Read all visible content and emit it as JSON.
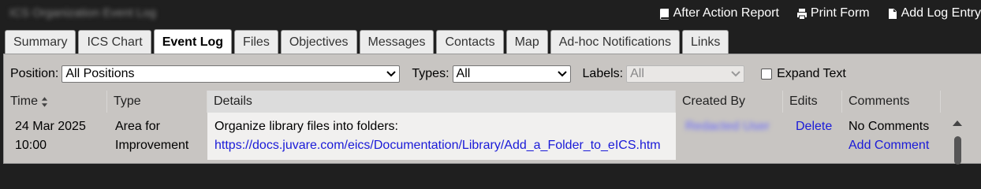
{
  "header": {
    "blurred_title": "ICS Organization Event Log",
    "actions": [
      {
        "label": "After Action Report",
        "icon": "book-icon"
      },
      {
        "label": "Print Form",
        "icon": "printer-icon"
      },
      {
        "label": "Add Log Entry",
        "icon": "document-icon"
      }
    ]
  },
  "tabs": [
    "Summary",
    "ICS Chart",
    "Event Log",
    "Files",
    "Objectives",
    "Messages",
    "Contacts",
    "Map",
    "Ad-hoc Notifications",
    "Links"
  ],
  "active_tab": "Event Log",
  "filters": {
    "position_label": "Position:",
    "position_value": "All Positions",
    "types_label": "Types:",
    "types_value": "All",
    "labels_label": "Labels:",
    "labels_value": "All",
    "expand_text_label": "Expand Text"
  },
  "table": {
    "columns": [
      "Time",
      "Type",
      "Details",
      "Created By",
      "Edits",
      "Comments"
    ],
    "rows": [
      {
        "time_date": "24 Mar 2025",
        "time_clock": "10:00",
        "type_line1": "Area for",
        "type_line2": "Improvement",
        "details_text": "Organize library files into folders:",
        "details_link": "https://docs.juvare.com/eics/Documentation/Library/Add_a_Folder_to_eICS.htm",
        "created_by": "Redacted User",
        "edit_action": "Delete",
        "comments_text": "No Comments",
        "comments_action": "Add Comment"
      }
    ]
  },
  "colors": {
    "link": "#1a1ad8",
    "panel": "#c8c5c2",
    "topbar": "#1f1f1f"
  }
}
